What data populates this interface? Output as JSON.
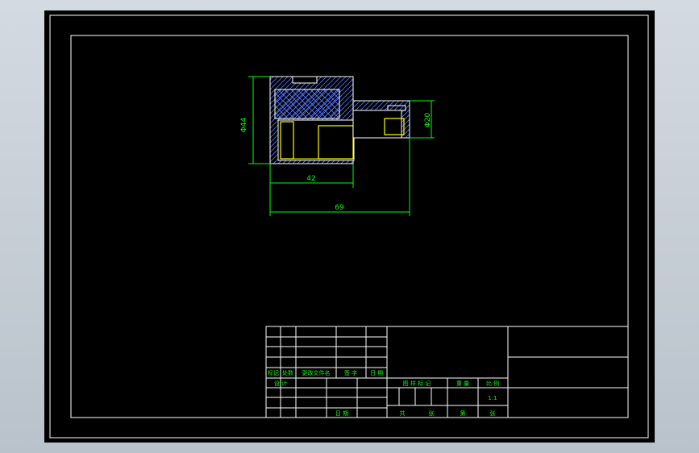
{
  "drawing": {
    "background": "#000000",
    "frame_color": "#ffffff",
    "dimension_color": "#00ff00",
    "outline_color": "#ffffff",
    "hatch_color": "#5577ff",
    "part_color": "#ffff00"
  },
  "dimensions": {
    "outer_diameter": "Φ44",
    "small_diameter": "Φ20",
    "inner_length": "42",
    "total_length": "69"
  },
  "title_block": {
    "rev_headers": [
      "标记",
      "处数",
      "更改文件名",
      "签 字",
      "日 期"
    ],
    "design": "设 计",
    "date": "日 期",
    "stage_headers": [
      "图 样 标 记",
      "重 量",
      "比 例"
    ],
    "scale": "1:1",
    "total_label": "共",
    "sheet_label": "张",
    "index_label": "第",
    "sheet_label_2": "张"
  }
}
